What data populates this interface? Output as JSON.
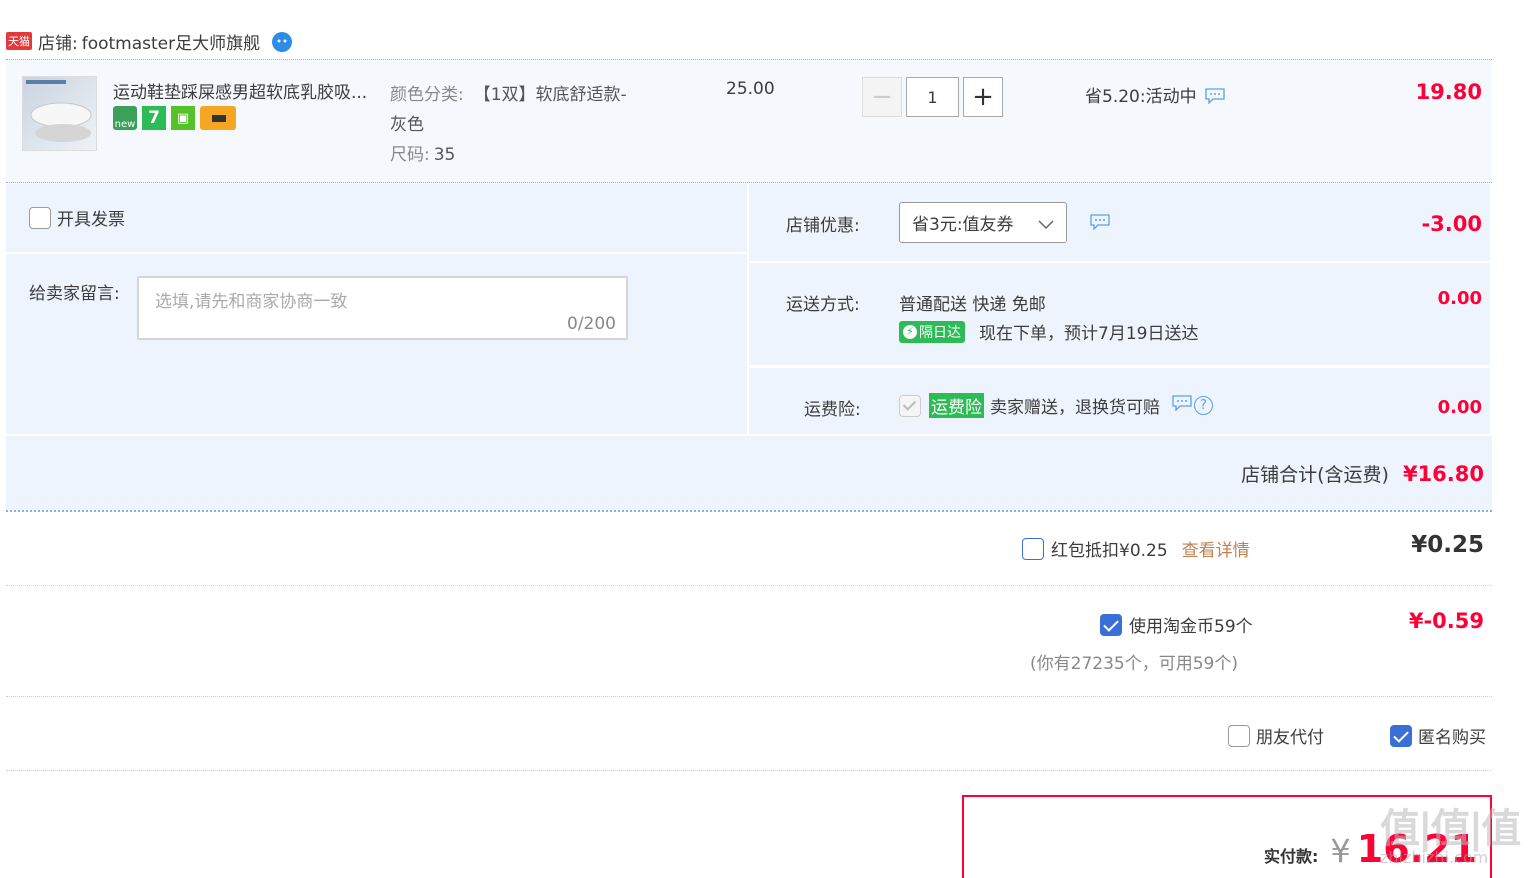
{
  "shop": {
    "badge": "天猫",
    "label": "店铺:",
    "name": "footmaster足大师旗舰"
  },
  "item": {
    "title": "运动鞋垫踩屎感男超软底乳胶吸...",
    "sku_label": "颜色分类:",
    "sku_value_1": "【1双】软底舒适款-",
    "sku_value_2": "灰色",
    "size_label": "尺码:",
    "size_value": "35",
    "unit_price": "25.00",
    "quantity": "1",
    "promo": "省5.20:活动中",
    "subtotal": "19.80",
    "badges": [
      "new",
      "7",
      "保",
      "卡"
    ]
  },
  "invoice": {
    "label": "开具发票"
  },
  "message": {
    "label": "给卖家留言:",
    "placeholder": "选填,请先和商家协商一致",
    "counter": "0/200"
  },
  "shop_discount": {
    "label": "店铺优惠:",
    "selected": "省3元:值友券",
    "amount": "-3.00"
  },
  "shipping": {
    "label": "运送方式:",
    "method": "普通配送 快递 免邮",
    "badge": "隔日达",
    "estimate": "现在下单，预计7月19日送达",
    "amount": "0.00"
  },
  "insurance": {
    "label": "运费险:",
    "tag": "运费险",
    "desc": "卖家赠送，退换货可赔",
    "amount": "0.00"
  },
  "shop_total": {
    "label": "店铺合计(含运费)",
    "amount": "¥16.80"
  },
  "redpacket": {
    "label": "红包抵扣¥0.25",
    "link": "查看详情",
    "amount": "¥0.25"
  },
  "coins": {
    "label": "使用淘金币59个",
    "note": "(你有27235个，可用59个)",
    "amount": "¥-0.59"
  },
  "options": {
    "friend_pay": "朋友代付",
    "anonymous": "匿名购买"
  },
  "pay": {
    "label": "实付款:",
    "currency": "¥",
    "amount": "16.21"
  },
  "watermark": {
    "text": "值|值|值",
    "sub": "zhizhizhi.com"
  },
  "colors": {
    "price_red": "#ff0036",
    "panel_bg": "#eef4fd",
    "accent_blue": "#3b6fd8",
    "link_orange": "#c08050",
    "green": "#2dbb55"
  }
}
